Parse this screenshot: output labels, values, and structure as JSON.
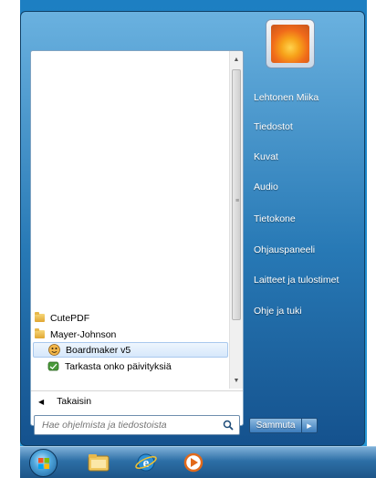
{
  "programs": {
    "items": [
      {
        "label": "CutePDF",
        "type": "folder"
      },
      {
        "label": "Mayer-Johnson",
        "type": "folder"
      },
      {
        "label": "Boardmaker v5",
        "type": "app",
        "selected": true
      },
      {
        "label": "Tarkasta onko päivityksiä",
        "type": "app"
      }
    ],
    "back_label": "Takaisin"
  },
  "search": {
    "placeholder": "Hae ohjelmista ja tiedostoista"
  },
  "right_pane": {
    "items": [
      {
        "label": "Lehtonen Miika"
      },
      {
        "label": "Tiedostot"
      },
      {
        "label": "Kuvat"
      },
      {
        "label": "Audio"
      },
      {
        "label": "Tietokone"
      },
      {
        "label": "Ohjauspaneeli"
      },
      {
        "label": "Laitteet ja tulostimet"
      },
      {
        "label": "Ohje ja tuki"
      }
    ]
  },
  "shutdown": {
    "label": "Sammuta"
  },
  "taskbar": {
    "items": [
      "start-orb",
      "explorer-icon",
      "internet-explorer-icon",
      "media-player-icon"
    ]
  }
}
